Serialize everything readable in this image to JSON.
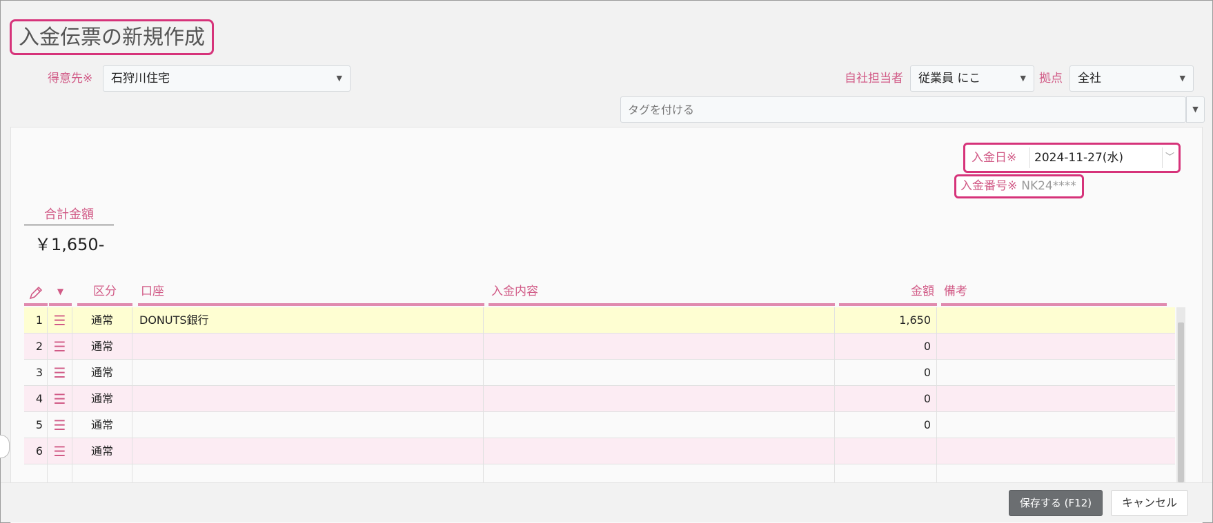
{
  "page": {
    "title": "入金伝票の新規作成"
  },
  "customer": {
    "label": "得意先※",
    "value": "石狩川住宅"
  },
  "staff": {
    "label": "自社担当者",
    "value": "従業員 にこ"
  },
  "base": {
    "label": "拠点",
    "value": "全社"
  },
  "tags": {
    "placeholder": "タグを付ける"
  },
  "payment_date": {
    "label": "入金日※",
    "value": "2024-11-27(水)"
  },
  "payment_number": {
    "label": "入金番号※",
    "value": "NK24****"
  },
  "total": {
    "label": "合計金額",
    "value": "￥1,650-"
  },
  "table": {
    "headers": {
      "kubun": "区分",
      "account": "口座",
      "content": "入金内容",
      "amount": "金額",
      "note": "備考"
    },
    "rows": [
      {
        "no": "1",
        "kubun": "通常",
        "account": "DONUTS銀行",
        "content": "",
        "amount": "1,650",
        "note": ""
      },
      {
        "no": "2",
        "kubun": "通常",
        "account": "",
        "content": "",
        "amount": "0",
        "note": ""
      },
      {
        "no": "3",
        "kubun": "通常",
        "account": "",
        "content": "",
        "amount": "0",
        "note": ""
      },
      {
        "no": "4",
        "kubun": "通常",
        "account": "",
        "content": "",
        "amount": "0",
        "note": ""
      },
      {
        "no": "5",
        "kubun": "通常",
        "account": "",
        "content": "",
        "amount": "0",
        "note": ""
      },
      {
        "no": "6",
        "kubun": "通常",
        "account": "",
        "content": "",
        "amount": "",
        "note": ""
      }
    ]
  },
  "footer": {
    "save_label": "保存する (F12)",
    "cancel_label": "キャンセル"
  },
  "colors": {
    "accent": "#d6337a",
    "label_pink": "#d15a86",
    "row_yellow": "#fefed2",
    "row_pink": "#fcecf3",
    "save_button": "#6b6e71"
  },
  "icons": {
    "edit": "pencil-icon",
    "column_menu": "caret-down-icon",
    "row_handle": "hamburger-icon",
    "dropdown": "chevron-down-icon"
  }
}
